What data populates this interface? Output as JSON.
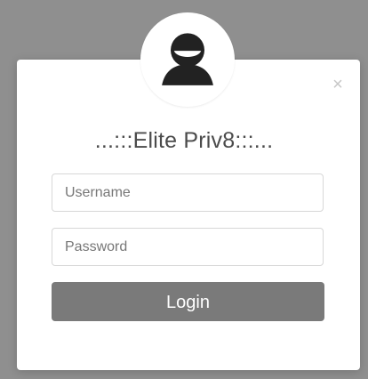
{
  "modal": {
    "title": "...:::Elite Priv8:::...",
    "close_label": "×",
    "avatar_icon": "smiling-user-icon",
    "username_placeholder": "Username",
    "password_placeholder": "Password",
    "login_label": "Login"
  },
  "colors": {
    "backdrop": "#8f8f8f",
    "modal_background": "#ffffff",
    "title_text": "#4b4b4b",
    "input_border": "#d7d7d7",
    "button_background": "#7a7a7a",
    "button_text": "#ffffff",
    "avatar_fill": "#222222"
  }
}
